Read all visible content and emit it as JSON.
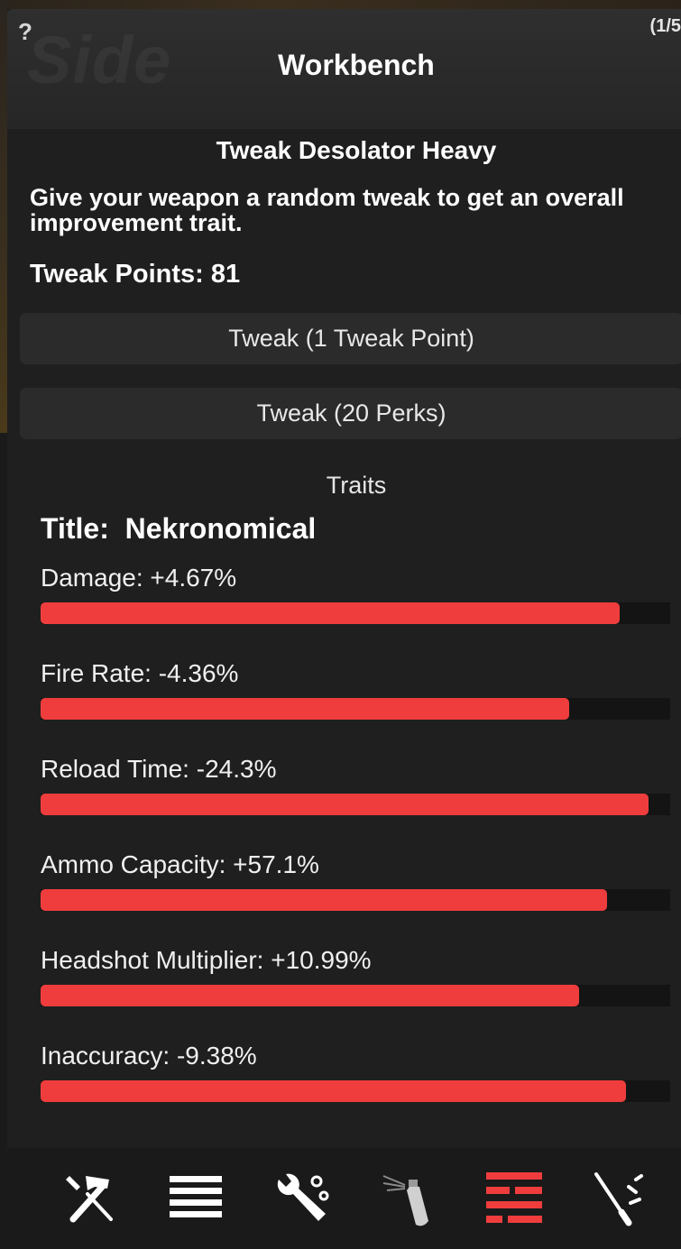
{
  "window": {
    "watermark": "Side",
    "help_icon": "?",
    "page_counter": "(1/5",
    "title": "Workbench"
  },
  "tweak": {
    "weapon_title": "Tweak Desolator Heavy",
    "description": "Give your weapon a random tweak to get an overall improvement trait.",
    "points_text": "Tweak Points: 81",
    "button_point": "Tweak (1 Tweak Point)",
    "button_perks": "Tweak (20 Perks)"
  },
  "traits": {
    "heading": "Traits",
    "title_text": "Title:  Nekronomical",
    "items": [
      {
        "label": "Damage: +4.67%",
        "fill": 0.92
      },
      {
        "label": "Fire Rate: -4.36%",
        "fill": 0.84
      },
      {
        "label": "Reload Time: -24.3%",
        "fill": 0.965
      },
      {
        "label": "Ammo Capacity: +57.1%",
        "fill": 0.9
      },
      {
        "label": "Headshot Multiplier: +10.99%",
        "fill": 0.855
      },
      {
        "label": "Inaccuracy: -9.38%",
        "fill": 0.93
      }
    ],
    "fill_color": "#ef3d3d"
  },
  "toolbar": {
    "icons": [
      "hammer-screwdriver-icon",
      "list-icon",
      "wrench-gears-icon",
      "spray-can-icon",
      "sliders-icon",
      "tools-icon"
    ],
    "active_color": "#ef3d3d",
    "icon_color": "#ffffff",
    "disabled_color": "#8a8a8a"
  }
}
